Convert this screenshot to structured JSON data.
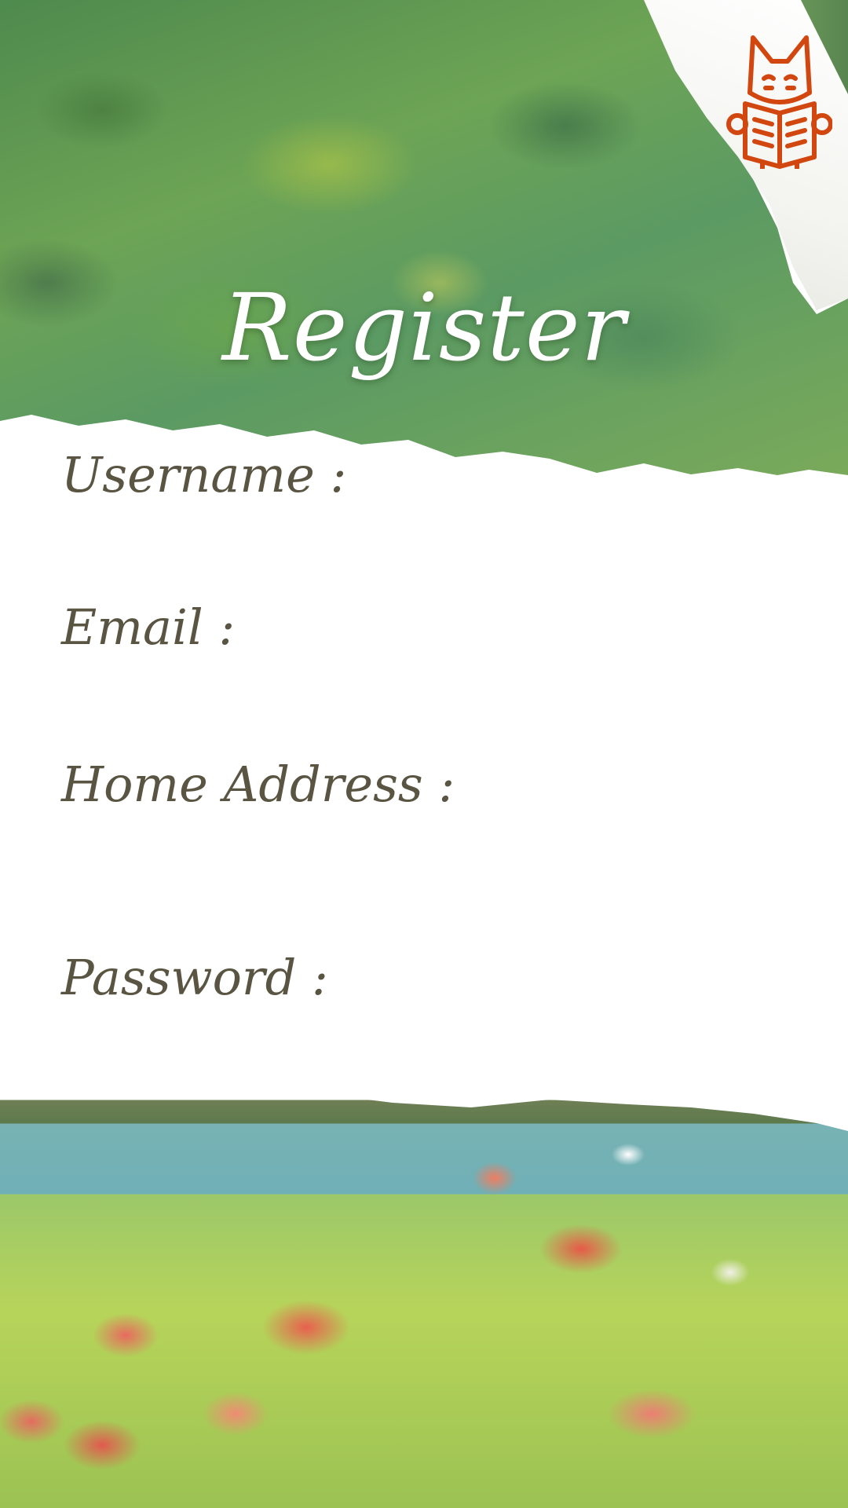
{
  "app": {
    "title": "Register",
    "logo_icon": "fox-reading-book-icon",
    "accent_color": "#D2470F"
  },
  "form": {
    "fields": [
      {
        "label": "Username :",
        "value": ""
      },
      {
        "label": "Email :",
        "value": ""
      },
      {
        "label": "Home Address :",
        "value": ""
      },
      {
        "label": "Password :",
        "value": ""
      }
    ]
  }
}
